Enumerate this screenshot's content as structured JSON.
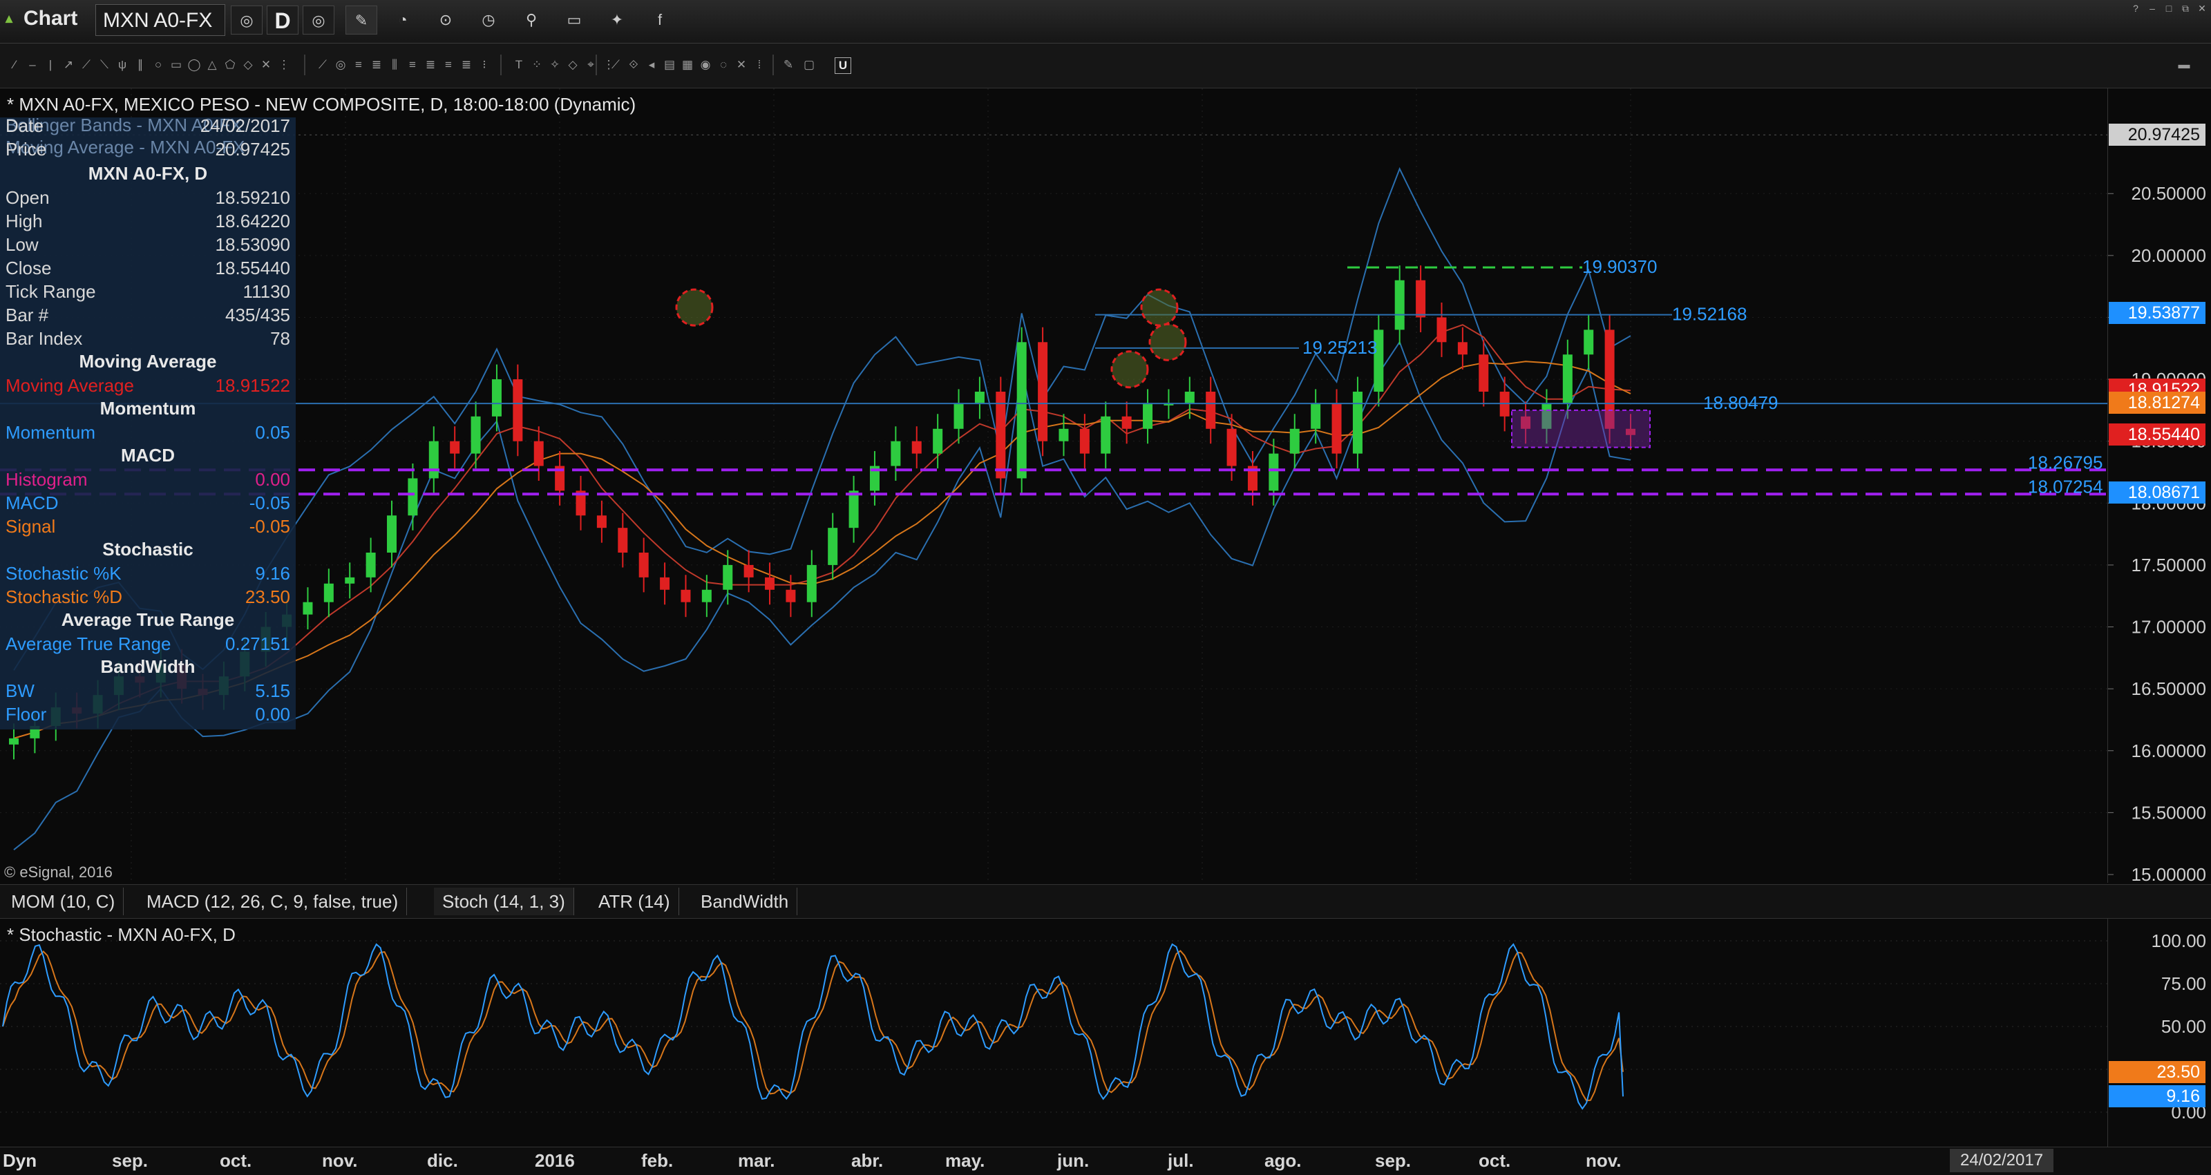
{
  "titlebar": {
    "app_title": "Chart",
    "symbol": "MXN A0-FX",
    "interval": "D"
  },
  "chart": {
    "header": "* MXN A0-FX, MEXICO PESO - NEW COMPOSITE, D, 18:00-18:00 (Dynamic)",
    "overlay_bollinger": "Bollinger Bands - MXN A0-FX",
    "overlay_ma": "Moving Average - MXN A0-FX",
    "copyright": "© eSignal, 2016",
    "price_axis_ticks": [
      "20.50000",
      "20.00000",
      "19.50000",
      "19.00000",
      "18.50000",
      "18.00000",
      "17.50000",
      "17.00000",
      "16.50000",
      "16.00000",
      "15.50000",
      "15.00000"
    ],
    "price_tags": [
      {
        "text": "20.97425",
        "color": "#cfcfcf"
      },
      {
        "text": "19.53877",
        "color": "#1e90ff"
      },
      {
        "text": "18.91522",
        "color": "#e02020"
      },
      {
        "text": "18.81274",
        "color": "#f07a1a"
      },
      {
        "text": "18.55440",
        "color": "#e02020"
      },
      {
        "text": "18.08671",
        "color": "#1e90ff"
      }
    ],
    "line_labels": {
      "l1": "19.90370",
      "l2": "19.52168",
      "l3": "19.25213",
      "l4": "18.80479",
      "l5": "18.26795",
      "l6": "18.07254"
    }
  },
  "data_window": {
    "date_label": "Date",
    "date_value": "24/02/2017",
    "price_label": "Price",
    "price_value": "20.97425",
    "symbol_head": "MXN A0-FX, D",
    "rows": [
      {
        "label": "Open",
        "value": "18.59210"
      },
      {
        "label": "High",
        "value": "18.64220"
      },
      {
        "label": "Low",
        "value": "18.53090"
      },
      {
        "label": "Close",
        "value": "18.55440"
      },
      {
        "label": "Tick Range",
        "value": "11130"
      },
      {
        "label": "Bar #",
        "value": "435/435"
      },
      {
        "label": "Bar Index",
        "value": "78"
      }
    ],
    "ma_head": "Moving Average",
    "ma_label": "Moving Average",
    "ma_value": "18.91522",
    "mom_head": "Momentum",
    "mom_label": "Momentum",
    "mom_value": "0.05",
    "macd_head": "MACD",
    "hist_label": "Histogram",
    "hist_value": "0.00",
    "macd_label": "MACD",
    "macd_value": "-0.05",
    "signal_label": "Signal",
    "signal_value": "-0.05",
    "stoch_head": "Stochastic",
    "stoch_k_label": "Stochastic %K",
    "stoch_k_value": "9.16",
    "stoch_d_label": "Stochastic %D",
    "stoch_d_value": "23.50",
    "atr_head": "Average True Range",
    "atr_label": "Average True Range",
    "atr_value": "0.27151",
    "bw_head": "BandWidth",
    "bw_label": "BW",
    "bw_value": "5.15",
    "floor_label": "Floor",
    "floor_value": "0.00"
  },
  "tabs": [
    "MOM (10, C)",
    "MACD (12, 26, C, 9, false, true)",
    "Stoch (14, 1, 3)",
    "ATR (14)",
    "BandWidth"
  ],
  "active_tab": 2,
  "lower": {
    "title": "* Stochastic - MXN A0-FX, D",
    "ticks": [
      "100.00",
      "75.00",
      "50.00",
      "25.00",
      "0.00"
    ],
    "tag_d": "23.50",
    "tag_k": "9.16"
  },
  "time_axis": {
    "dyn": "Dyn",
    "months": [
      "sep.",
      "oct.",
      "nov.",
      "dic.",
      "2016",
      "feb.",
      "mar.",
      "abr.",
      "may.",
      "jun.",
      "jul.",
      "ago.",
      "sep.",
      "oct.",
      "nov."
    ],
    "cursor_date": "24/02/2017"
  },
  "chart_data": {
    "type": "candlestick",
    "title": "* MXN A0-FX, MEXICO PESO - NEW COMPOSITE, D, 18:00-18:00 (Dynamic)",
    "ylim": [
      15.0,
      21.0
    ],
    "month_labels": [
      "sep.",
      "oct.",
      "nov.",
      "dic.",
      "2016",
      "feb.",
      "mar.",
      "abr.",
      "may.",
      "jun.",
      "jul.",
      "ago.",
      "sep.",
      "oct.",
      "nov."
    ],
    "close_path": [
      16.1,
      16.2,
      16.35,
      16.3,
      16.45,
      16.6,
      16.55,
      16.7,
      16.5,
      16.45,
      16.6,
      16.8,
      17.0,
      17.1,
      17.2,
      17.35,
      17.4,
      17.6,
      17.9,
      18.2,
      18.5,
      18.4,
      18.7,
      19.0,
      18.5,
      18.3,
      18.1,
      17.9,
      17.8,
      17.6,
      17.4,
      17.3,
      17.2,
      17.3,
      17.5,
      17.4,
      17.3,
      17.2,
      17.5,
      17.8,
      18.1,
      18.3,
      18.5,
      18.4,
      18.6,
      18.8,
      18.9,
      18.2,
      19.3,
      18.5,
      18.6,
      18.4,
      18.7,
      18.6,
      18.8,
      18.8,
      18.9,
      18.6,
      18.3,
      18.1,
      18.4,
      18.6,
      18.8,
      18.4,
      18.9,
      19.4,
      19.8,
      19.5,
      19.3,
      19.2,
      18.9,
      18.7,
      18.6,
      18.8,
      19.2,
      19.4,
      18.6,
      18.55
    ],
    "last": {
      "open": 18.5921,
      "high": 18.6422,
      "low": 18.5309,
      "close": 18.5544
    },
    "horizontal_lines": [
      19.9037,
      19.52168,
      19.25213,
      18.80479,
      18.26795,
      18.07254
    ],
    "stochastic": {
      "k_last": 9.16,
      "d_last": 23.5
    }
  }
}
